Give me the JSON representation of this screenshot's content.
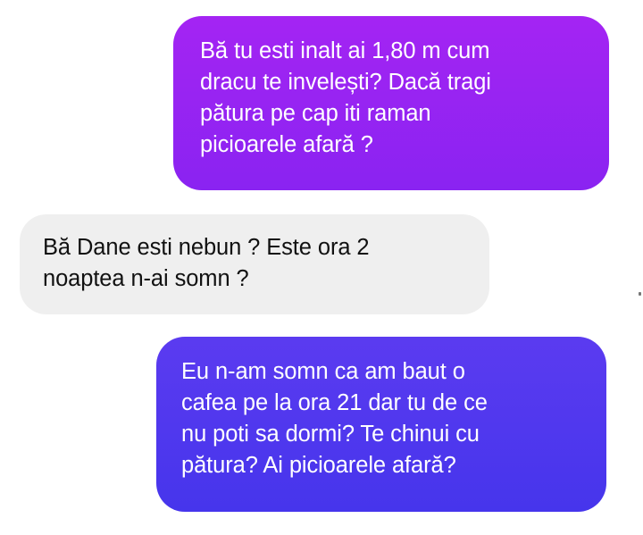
{
  "conversation": {
    "messages": [
      {
        "sender": "me",
        "text": "Bă tu esti inalt ai 1,80 m cum\ndracu te invelești? Dacă tragi\npătura pe cap iti raman\npicioarele afară ?",
        "color": "#9a25f2"
      },
      {
        "sender": "other",
        "text": "Bă Dane esti nebun ? Este ora 2\nnoaptea n-ai somn ?",
        "color": "#efefef"
      },
      {
        "sender": "me",
        "text": "Eu n-am somn ca am baut o\ncafea pe la ora 21 dar tu de ce\nnu poti sa dormi? Te chinui cu\npătura? Ai picioarele afară?",
        "color": "#4f38ee"
      }
    ]
  }
}
